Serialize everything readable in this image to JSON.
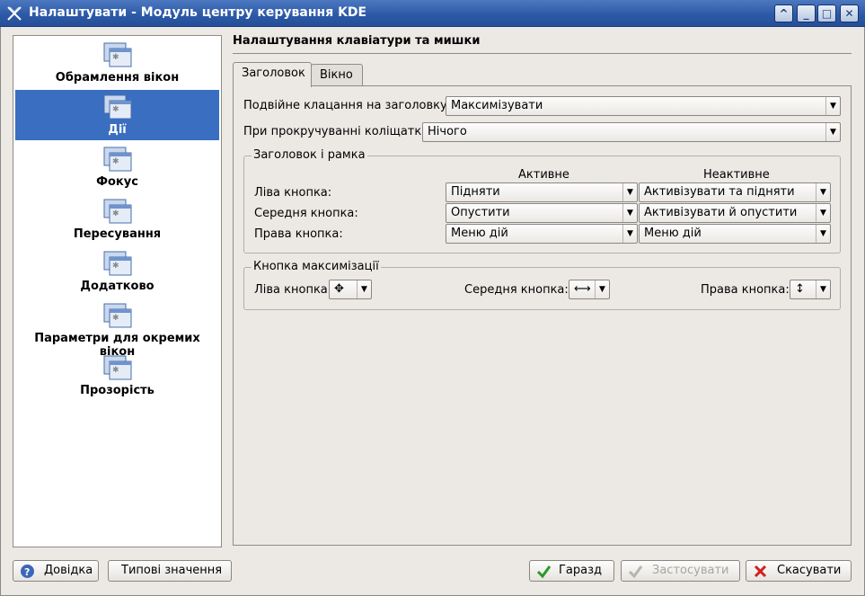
{
  "window": {
    "title": "Налаштувати - Модуль центру керування KDE",
    "controls": {
      "shade": "^",
      "minimize": "_",
      "maximize": "□",
      "close": "✕"
    }
  },
  "sidebar": {
    "items": [
      {
        "label": "Обрамлення вікон",
        "selected": false
      },
      {
        "label": "Дії",
        "selected": true
      },
      {
        "label": "Фокус",
        "selected": false
      },
      {
        "label": "Пересування",
        "selected": false
      },
      {
        "label": "Додатково",
        "selected": false
      },
      {
        "label": "Параметри для окремих вікон",
        "selected": false
      },
      {
        "label": "Прозорість",
        "selected": false
      }
    ]
  },
  "main": {
    "heading": "Налаштування клавіатури та мишки",
    "tabs": [
      {
        "label": "Заголовок",
        "active": true
      },
      {
        "label": "Вікно",
        "active": false
      }
    ],
    "double_click": {
      "label": "Подвійне клацання на заголовку:",
      "value": "Максимізувати"
    },
    "wheel": {
      "label": "При прокручуванні коліщатка",
      "value": "Нічого"
    },
    "titlebar_frame": {
      "title": "Заголовок і рамка",
      "col_active": "Активне",
      "col_inactive": "Неактивне",
      "rows": [
        {
          "label": "Ліва кнопка:",
          "active": "Підняти",
          "inactive": "Активізувати та підняти"
        },
        {
          "label": "Середня кнопка:",
          "active": "Опустити",
          "inactive": "Активізувати й опустити"
        },
        {
          "label": "Права кнопка:",
          "active": "Меню дій",
          "inactive": "Меню дій"
        }
      ]
    },
    "maximize_button": {
      "title": "Кнопка максимізації",
      "left_label": "Ліва кнопка:",
      "left_icon": "✥",
      "middle_label": "Середня кнопка:",
      "middle_icon": "⟷",
      "right_label": "Права кнопка:",
      "right_icon": "↕"
    }
  },
  "buttons": {
    "help": "Довідка",
    "defaults": "Типові значення",
    "ok": "Гаразд",
    "apply": "Застосувати",
    "cancel": "Скасувати"
  },
  "colors": {
    "selection": "#3a6ec0",
    "titlebar": "#2d5aa8",
    "ok_icon": "#2a9a2a",
    "cancel_icon": "#d02020",
    "help_icon": "#3b67b8"
  }
}
